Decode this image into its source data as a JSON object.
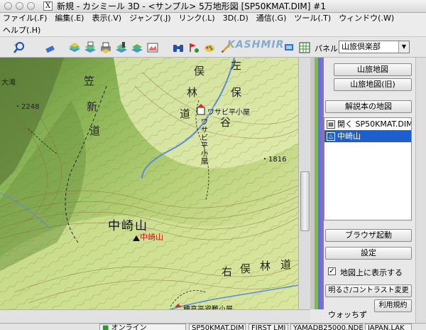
{
  "window": {
    "title": "新規 - カシミール 3D - <サンプル> 5万地形図 [SP50KMAT.DIM] #1",
    "title_icon": "X"
  },
  "menu": {
    "row1": [
      "ファイル(.F)",
      "編集(.E)",
      "表示(.V)",
      "ジャンプ(.J)",
      "リンク(.L)",
      "3D(.D)",
      "通信(.G)",
      "ツール(.T)",
      "ウィンドウ(.W)"
    ],
    "row2": [
      "ヘルプ(.H)"
    ]
  },
  "toolbar": {
    "watermark": "KASHMIR",
    "icons": [
      "zoom-icon",
      "eraser-icon",
      "layers-icon",
      "layers-print-icon",
      "print-icon",
      "layer-edit-icon",
      "map-color-icon",
      "binoculars-icon",
      "marker-icon",
      "paint-icon",
      "pencil-icon",
      "gps-icon",
      "grid-icon"
    ],
    "panel_label": "パネル",
    "panel_value": "山旅倶楽部"
  },
  "map": {
    "labels": [
      {
        "text": "左",
        "kind": "area"
      },
      {
        "text": "保",
        "kind": "area"
      },
      {
        "text": "俣",
        "kind": "area"
      },
      {
        "text": "林",
        "kind": "area"
      },
      {
        "text": "道",
        "kind": "area"
      },
      {
        "text": "谷",
        "kind": "area"
      },
      {
        "text": "笠",
        "kind": "area"
      },
      {
        "text": "新",
        "kind": "area"
      },
      {
        "text": "道",
        "kind": "area"
      },
      {
        "text": "大滝",
        "kind": "small"
      },
      {
        "text": "・2248",
        "kind": "elev"
      },
      {
        "text": "ワサビ平小屋",
        "kind": "hut"
      },
      {
        "text": "ワサビ平小屋",
        "kind": "vertical"
      },
      {
        "text": "・1816",
        "kind": "elev"
      },
      {
        "text": "中崎山",
        "kind": "peak"
      },
      {
        "text": "中崎山",
        "kind": "peak-red"
      },
      {
        "text": "右",
        "kind": "area"
      },
      {
        "text": "俣",
        "kind": "area"
      },
      {
        "text": "林",
        "kind": "area"
      },
      {
        "text": "道",
        "kind": "area"
      },
      {
        "text": "穂高平避難小屋",
        "kind": "hut"
      }
    ]
  },
  "sidepanel": {
    "btn_sanryo_map": "山旅地図",
    "btn_sanryo_map_old": "山旅地図(旧)",
    "btn_guide_map": "解説本の地図",
    "list_items": [
      {
        "label": "開く SP50KMAT.DIM",
        "icon": "folder-icon",
        "selected": false
      },
      {
        "label": "中崎山",
        "icon": "mountain-icon",
        "selected": true
      }
    ],
    "btn_browser": "ブラウザ起動",
    "btn_settings": "設定",
    "show_on_map_checked": true,
    "show_on_map_label": "地図上に表示する",
    "btn_brightness": "明るさ/コントラスト変更",
    "btn_terms": "利用規約",
    "watch_label": "ウォッちず"
  },
  "status": {
    "online": "オンライン",
    "file": "SP50KMAT.DIM",
    "layer": "FIRST LMI",
    "dataset": "YAMADB25000.NDB",
    "region": "JAPAN.LAK"
  },
  "colors": {
    "selection": "#1e5fd0",
    "map_green": "#9cc46a",
    "map_light": "#e6efb4",
    "strip_green": "#7fbf3a",
    "strip_blue": "#5a78d8",
    "strip_purple": "#8a6cc4"
  }
}
